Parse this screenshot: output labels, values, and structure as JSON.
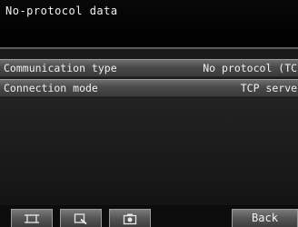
{
  "title": "No-protocol data",
  "rows": [
    {
      "label": "Communication type",
      "value": "No protocol (TCP"
    },
    {
      "label": "Connection mode",
      "value": "TCP server"
    }
  ],
  "toolbar": {
    "icons": [
      "fit-frame-icon",
      "zoom-icon",
      "camera-icon"
    ],
    "back_label": "Back"
  }
}
